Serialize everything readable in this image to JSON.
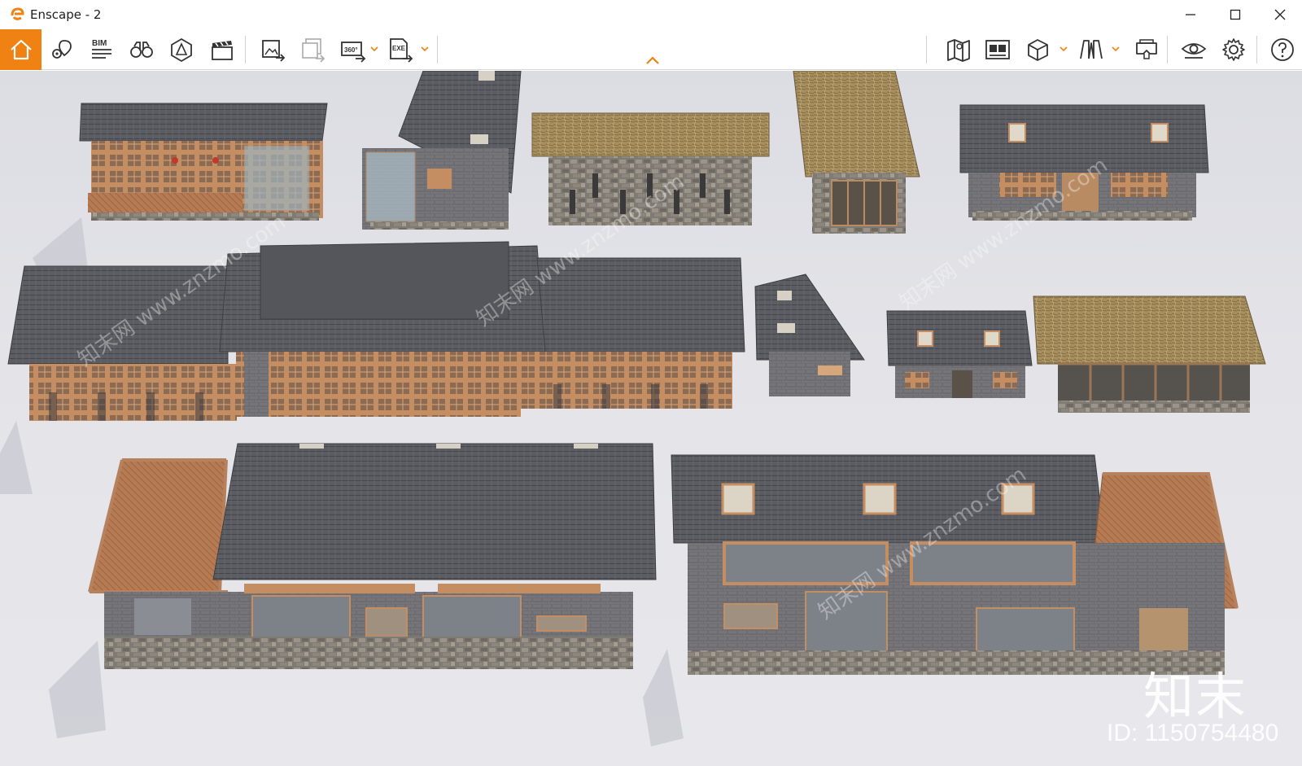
{
  "window": {
    "title": "Enscape - 2",
    "accent_color": "#f08213"
  },
  "toolbar": {
    "left_items": [
      {
        "name": "home-icon",
        "label": "Home"
      },
      {
        "name": "location-pin-icon",
        "label": "Views"
      },
      {
        "name": "bim-icon",
        "label": "BIM"
      },
      {
        "name": "binoculars-icon",
        "label": "Walk mode"
      },
      {
        "name": "perspective-cube-icon",
        "label": "Perspective"
      },
      {
        "name": "clapperboard-icon",
        "label": "Video editor"
      },
      {
        "name": "render-image-icon",
        "label": "Render image"
      },
      {
        "name": "batch-render-icon",
        "label": "Batch render"
      },
      {
        "name": "panorama-360-icon",
        "label": "360"
      },
      {
        "name": "export-exe-icon",
        "label": "EXE"
      }
    ],
    "right_items": [
      {
        "name": "map-icon",
        "label": "Map"
      },
      {
        "name": "gallery-icon",
        "label": "Gallery"
      },
      {
        "name": "asset-cube-icon",
        "label": "Assets"
      },
      {
        "name": "book-icon",
        "label": "Books"
      },
      {
        "name": "vr-headset-icon",
        "label": "VR"
      },
      {
        "name": "eye-icon",
        "label": "Visual settings"
      },
      {
        "name": "gear-icon",
        "label": "Settings"
      },
      {
        "name": "help-icon",
        "label": "Help"
      }
    ],
    "bim_text": "BIM",
    "pano_text": "360°",
    "exe_text": "EXE"
  },
  "watermark": {
    "logo_text": "知末",
    "id_text": "ID: 1150754480",
    "diag_text": "知末网 www.znzmo.com"
  }
}
